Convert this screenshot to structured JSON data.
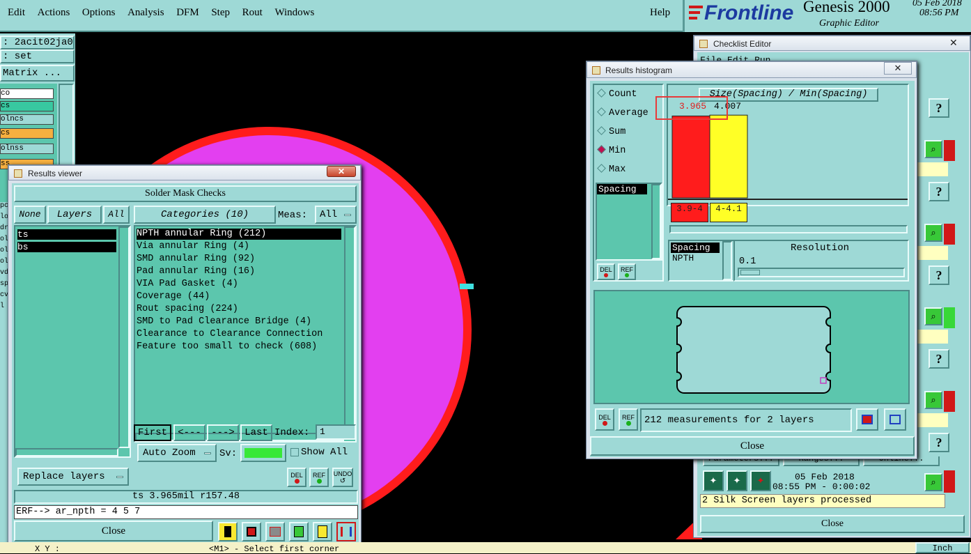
{
  "menubar": {
    "items": [
      "Edit",
      "Actions",
      "Options",
      "Analysis",
      "DFM",
      "Step",
      "Rout",
      "Windows"
    ],
    "help": "Help"
  },
  "brand": {
    "logo": "Frontline",
    "product": "Genesis 2000",
    "sub": "Graphic Editor",
    "date": "05 Feb 2018",
    "time": "08:56 PM"
  },
  "left_panel": {
    "job": ": 2acit02ja0",
    "set": ": set",
    "matrix": "Matrix ...",
    "layers": [
      "co",
      "cs",
      "olncs",
      "cs",
      "olnss",
      "ss"
    ],
    "side_letters": [
      "pc",
      "lo",
      "dr",
      "ol",
      "ol",
      "ol",
      "vd",
      "sp",
      "cv",
      "l"
    ]
  },
  "results_viewer": {
    "title": "Results viewer",
    "header": "Solder Mask Checks",
    "none_btn": "None",
    "layers_label": "Layers",
    "all_btn": "All",
    "layers": [
      "ts",
      "bs"
    ],
    "categories_label": "Categories (10)",
    "meas_label": "Meas:",
    "meas_value": "All",
    "categories": [
      "NPTH annular Ring (212)",
      "Via annular Ring (4)",
      "SMD annular Ring (92)",
      "Pad annular Ring (16)",
      "VIA Pad Gasket (4)",
      "Coverage (44)",
      "Rout spacing (224)",
      "SMD to Pad Clearance Bridge (4)",
      "Clearance to Clearance Connection",
      "Feature too small to check (608)"
    ],
    "first_btn": "First",
    "prev_btn": "<---",
    "next_btn": "--->",
    "last_btn": "Last",
    "index_label": "Index:",
    "index_value": "1",
    "zoom_label": "Auto Zoom",
    "sv_label": "Sv:",
    "show_all": "Show All",
    "replace_label": "Replace layers",
    "status": "ts 3.965mil   r157.48",
    "erf": "ERF--> ar_npth = 4 5 7",
    "close": "Close",
    "del": "DEL",
    "ref": "REF",
    "undo": "UNDO"
  },
  "histogram": {
    "title": "Results histogram",
    "options": [
      "Count",
      "Average",
      "Sum",
      "Min",
      "Max"
    ],
    "selected_option": "Min",
    "spacing_item": "Spacing",
    "chart_title": "Size(Spacing) / Min(Spacing)",
    "close": "Close",
    "resolution_label": "Resolution",
    "resolution_value": "0.1",
    "list_items": [
      "Spacing",
      "NPTH"
    ],
    "measurements": "212 measurements for 2 layers",
    "del": "DEL",
    "ref": "REF"
  },
  "checklist": {
    "title": "Checklist Editor",
    "menu": [
      "File",
      "Edit",
      "Run"
    ],
    "buttons": [
      "Parameters...",
      "Ranges...",
      "Online..."
    ],
    "date": "05 Feb 2018",
    "time": "08:55 PM - 0:00:02",
    "status": "2 Silk Screen layers processed",
    "close": "Close",
    "help_icon": "?"
  },
  "bottom": {
    "xy": "X Y :",
    "hint": "<M1> - Select first corner",
    "unit": "Inch"
  },
  "colors": {
    "teal": "#9ed9d6",
    "list": "#5cc6ad",
    "red": "#ff1c1c",
    "yellow": "#ffff26",
    "magenta": "#e33ff0"
  },
  "chart_data": {
    "type": "bar",
    "title": "Size(Spacing) / Min(Spacing)",
    "categories": [
      "3.9-4",
      "4-4.1"
    ],
    "series": [
      {
        "values": [
          3.965,
          4.007
        ]
      }
    ],
    "bar_colors": [
      "#ff1c1c",
      "#ffff26"
    ],
    "labels": [
      "3.965",
      "4.007"
    ]
  }
}
